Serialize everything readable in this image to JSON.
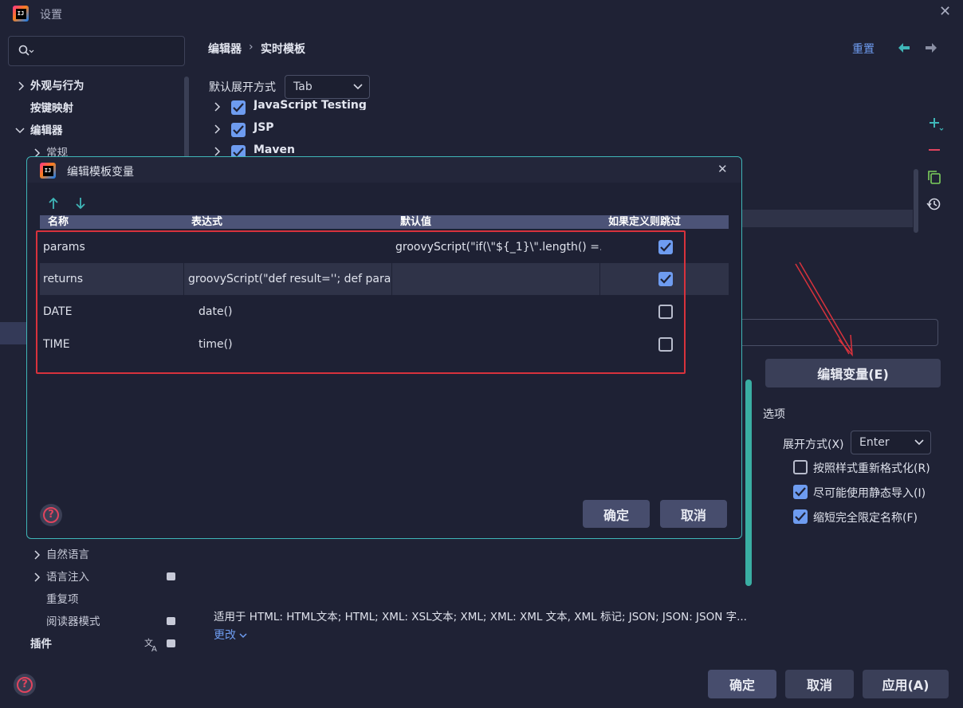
{
  "window": {
    "title": "设置"
  },
  "search": {
    "placeholder": ""
  },
  "tree": {
    "appearance": "外观与行为",
    "keymap": "按键映射",
    "editor": "编辑器",
    "general": "常规",
    "natural_language": "自然语言",
    "language_injection": "语言注入",
    "duplicates": "重复项",
    "reader_mode": "阅读器模式",
    "plugins": "插件"
  },
  "breadcrumb": {
    "part1": "编辑器",
    "sep": "›",
    "part2": "实时模板"
  },
  "header": {
    "reset": "重置"
  },
  "expand_default": {
    "label": "默认展开方式",
    "value": "Tab"
  },
  "templates": {
    "item0": "JavaScript Testing",
    "item1": "JSP",
    "item2": "Maven"
  },
  "edit_var_button": "编辑变量(E)",
  "options": {
    "title": "选项",
    "expand_label": "展开方式(X)",
    "expand_value": "Enter",
    "reformat": "按照样式重新格式化(R)",
    "static_import": "尽可能使用静态导入(I)",
    "shorten_fq": "缩短完全限定名称(F)"
  },
  "applicable": {
    "text": "适用于 HTML: HTML文本; HTML; XML: XSL文本; XML; XML: XML 文本, XML 标记; JSON; JSON: JSON 字...",
    "change": "更改"
  },
  "footer": {
    "ok": "确定",
    "cancel": "取消",
    "apply": "应用(A)"
  },
  "dialog": {
    "title": "编辑模板变量",
    "columns": {
      "name": "名称",
      "expr": "表达式",
      "default": "默认值",
      "skip": "如果定义则跳过"
    },
    "rows": [
      {
        "name": "params",
        "expr": "",
        "default": "groovyScript(\"if(\\\"${_1}\\\".length() =...",
        "skip": true
      },
      {
        "name": "returns",
        "expr": "groovyScript(\"def result=''; def para...",
        "default": "",
        "skip": true
      },
      {
        "name": "DATE",
        "expr": "date()",
        "default": "",
        "skip": false
      },
      {
        "name": "TIME",
        "expr": "time()",
        "default": "",
        "skip": false
      }
    ],
    "ok": "确定",
    "cancel": "取消"
  },
  "colors": {
    "accent": "#6e9cf0",
    "dialog_border": "#3fb6b8",
    "highlight": "#d8323c"
  }
}
